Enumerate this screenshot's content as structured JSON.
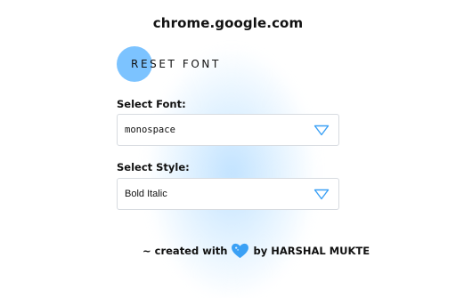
{
  "header": {
    "host": "chrome.google.com"
  },
  "reset": {
    "label": "RESET FONT"
  },
  "font_select": {
    "label": "Select Font:",
    "value": "monospace"
  },
  "style_select": {
    "label": "Select Style:",
    "value": "Bold Italic"
  },
  "footer": {
    "prefix": "~ created with",
    "suffix": "by HARSHAL MUKTE",
    "icon": "heart-icon"
  },
  "colors": {
    "accent": "#7cc3ff",
    "chevron": "#3aa0f5",
    "heart": "#3aa0f5"
  }
}
